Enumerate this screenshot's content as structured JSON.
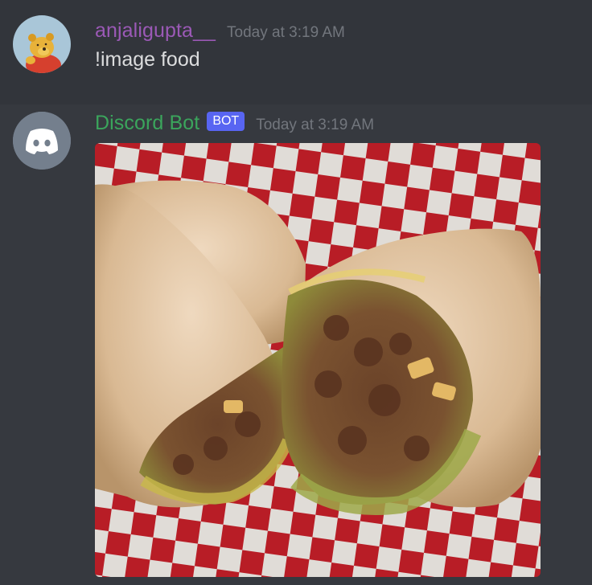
{
  "messages": {
    "user": {
      "username": "anjaligupta__",
      "timestamp": "Today at 3:19 AM",
      "content": "!image food",
      "name_color": "#9b59b6",
      "avatar_icon": "winnie-the-pooh-avatar"
    },
    "bot": {
      "username": "Discord Bot",
      "tag": "BOT",
      "timestamp": "Today at 3:19 AM",
      "name_color": "#3ba55c",
      "tag_color": "#5865f2",
      "avatar_icon": "discord-logo-icon",
      "attachment": "food-image-burrito"
    }
  },
  "colors": {
    "background": "#36393f",
    "hover_row": "#32353b",
    "text": "#dcddde",
    "muted": "#72767d"
  }
}
